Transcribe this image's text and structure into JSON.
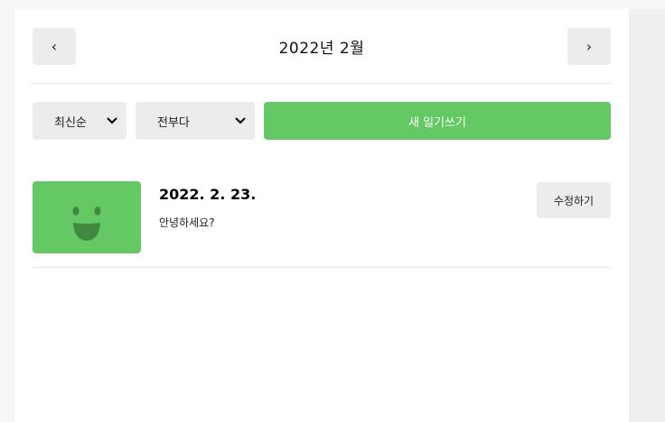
{
  "header": {
    "prev_icon": "chevron-left-icon",
    "prev_glyph": "‹",
    "title": "2022년 2월",
    "next_icon": "chevron-right-icon",
    "next_glyph": "›"
  },
  "controls": {
    "sort_value": "최신순",
    "filter_value": "전부다",
    "dropdown_glyph": "⌄",
    "new_button_label": "새 일기쓰기"
  },
  "diary_list": [
    {
      "date": "2022. 2. 23.",
      "content": "안녕하세요?",
      "emotion_icon": "smiley-face-icon",
      "edit_label": "수정하기"
    }
  ],
  "colors": {
    "accent_green": "#64c964",
    "button_gray": "#ececec",
    "face_dark_green": "#3f8a40"
  }
}
